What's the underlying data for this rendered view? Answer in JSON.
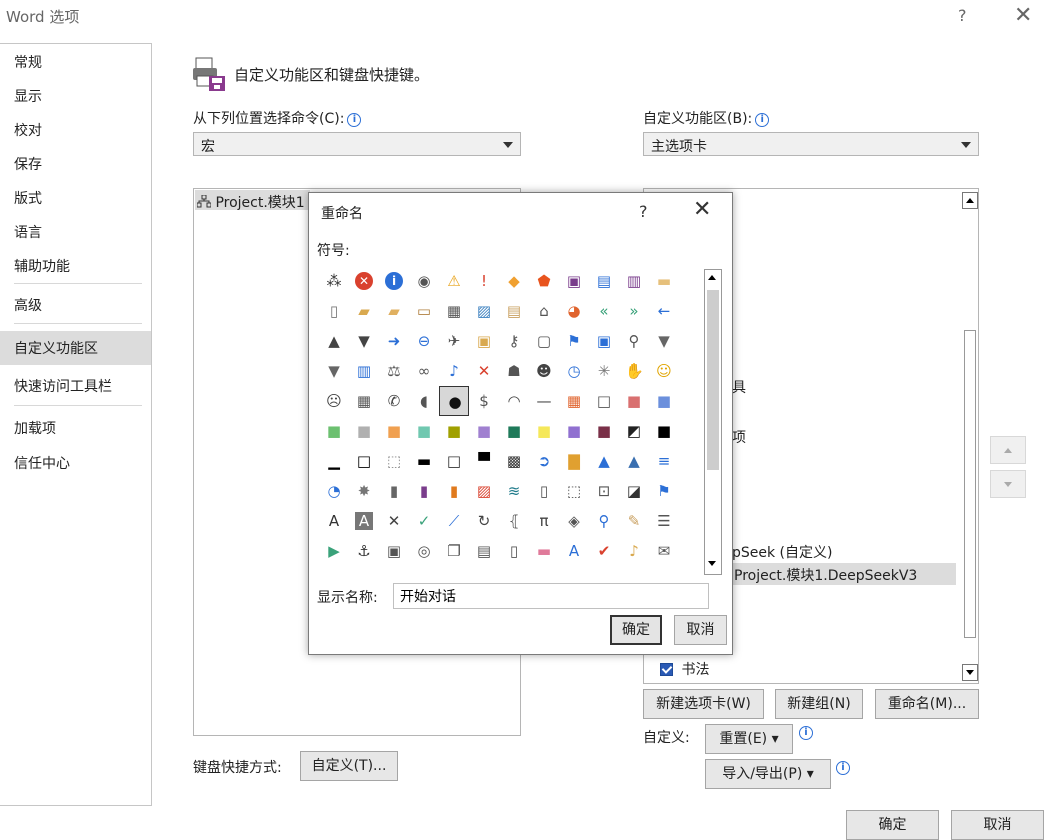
{
  "window": {
    "title": "Word 选项",
    "help": "?",
    "close": "✕"
  },
  "nav": {
    "items": [
      {
        "label": "常规",
        "selected": false
      },
      {
        "label": "显示",
        "selected": false
      },
      {
        "label": "校对",
        "selected": false
      },
      {
        "label": "保存",
        "selected": false
      },
      {
        "label": "版式",
        "selected": false
      },
      {
        "label": "语言",
        "selected": false
      },
      {
        "label": "辅助功能",
        "selected": false
      },
      {
        "label": "高级",
        "selected": false
      },
      {
        "label": "自定义功能区",
        "selected": true
      },
      {
        "label": "快速访问工具栏",
        "selected": false
      },
      {
        "label": "加载项",
        "selected": false
      },
      {
        "label": "信任中心",
        "selected": false
      }
    ]
  },
  "header": {
    "title": "自定义功能区和键盘快捷键。"
  },
  "left": {
    "commands_label": "从下列位置选择命令(C):",
    "commands_value": "宏",
    "list_item": "Project.模块1"
  },
  "right": {
    "ribbon_label": "自定义功能区(B):",
    "ribbon_value": "主选项卡",
    "tree_partial_1": "具",
    "tree_partial_2": "项",
    "tree_group": "pSeek (自定义)",
    "tree_selected": "Project.模块1.DeepSeekV3",
    "tree_last": "书法"
  },
  "buttons": {
    "new_tab": "新建选项卡(W)",
    "new_group": "新建组(N)",
    "rename": "重命名(M)...",
    "customize_label": "自定义:",
    "reset": "重置(E) ▾",
    "import_export": "导入/导出(P) ▾",
    "shortcut_label": "键盘快捷方式:",
    "customize_btn": "自定义(T)...",
    "ok": "确定",
    "cancel": "取消"
  },
  "dialog": {
    "title": "重命名",
    "help": "?",
    "close": "✕",
    "symbol_label": "符号:",
    "display_name_label": "显示名称:",
    "display_name_value": "开始对话",
    "ok": "确定",
    "cancel": "取消",
    "selected_symbol": "8-ball-icon"
  },
  "symbols": [
    [
      "org-chart-icon",
      "error-icon",
      "info-icon",
      "record-icon",
      "warning-icon",
      "exclamation-icon",
      "warning-diamond-icon",
      "shield-icon",
      "save-icon",
      "save-as-icon",
      "save-sync-icon",
      "folder-icon"
    ],
    [
      "document-icon",
      "folder-open-icon",
      "folders-icon",
      "drawer-icon",
      "print-icon",
      "picture-icon",
      "paste-icon",
      "home-icon",
      "pie-icon",
      "back-double-icon",
      "forward-double-icon",
      "arrow-left-icon"
    ],
    [
      "triangle-up-icon",
      "triangle-down-icon",
      "arrow-right-icon",
      "circle-left-icon",
      "pin-icon",
      "lock-icon",
      "key-icon",
      "note-icon",
      "flag-icon",
      "window-icon",
      "search-icon",
      "filter-icon"
    ],
    [
      "filter-icon",
      "book-icon",
      "scale-icon",
      "rings-icon",
      "microphone-icon",
      "mute-icon",
      "agent-icon",
      "person-icon",
      "clock-icon",
      "sparkle-icon",
      "hand-icon",
      "smiley-icon"
    ],
    [
      "sad-icon",
      "calculator-icon",
      "phone-icon",
      "piggy-bank-icon",
      "8-ball-icon",
      "dollar-icon",
      "eye-icon",
      "dash-icon",
      "palette-icon",
      "white-square-icon",
      "red-square-icon",
      "blue-square-icon"
    ],
    [
      "green-square-icon",
      "gray-square-icon",
      "orange-square-icon",
      "teal-square-icon",
      "olive-square-icon",
      "purple-square-icon",
      "darkgreen-square-icon",
      "yellow-square-icon",
      "violet-square-icon",
      "maroon-square-icon",
      "half-square-icon",
      "black-square-icon"
    ],
    [
      "bottom-border-icon",
      "border-icon",
      "dotted-square-icon",
      "middle-bar-icon",
      "empty-square-icon",
      "top-bar-icon",
      "checker-icon",
      "circle-arrow-icon",
      "bar-chart-icon",
      "cone-icon",
      "mountain-icon",
      "align-bars-icon"
    ],
    [
      "pie-chart-icon",
      "web-icon",
      "cylinders-icon",
      "purple-book-icon",
      "orange-book-icon",
      "pictures-icon",
      "chart-line-icon",
      "page-icon",
      "select-image-icon",
      "crop-icon",
      "slash-icon",
      "flag-arrow-icon"
    ],
    [
      "text-a-icon",
      "gray-a-icon",
      "cross-icon",
      "check-icon",
      "line-chart-icon",
      "refresh-icon",
      "brackets-icon",
      "pi-icon",
      "bucket-icon",
      "magnify-icon",
      "brush-icon",
      "list-icon"
    ],
    [
      "play-icon",
      "anchor-icon",
      "toolbox-icon",
      "shapes-icon",
      "copy-icon",
      "clipboard-icon",
      "blank-doc-icon",
      "eraser-icon",
      "text-style-icon",
      "vote-icon",
      "bell-icon",
      "mail-open-icon"
    ]
  ]
}
